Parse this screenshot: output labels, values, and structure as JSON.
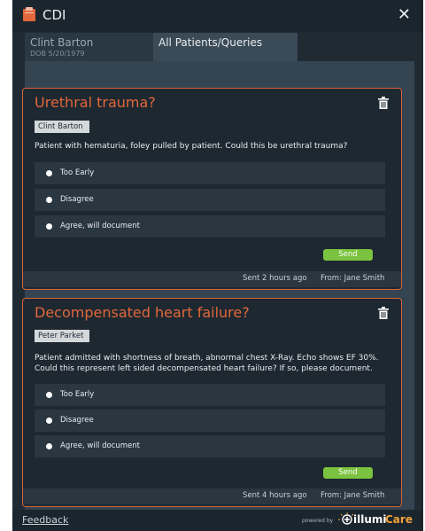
{
  "window": {
    "title": "CDI",
    "app_icon": "clipboard-icon",
    "close_icon": "close-icon"
  },
  "tabs": {
    "patient": {
      "name": "Clint Barton",
      "dob": "DOB 5/20/1979"
    },
    "all": {
      "label": "All Patients/Queries"
    }
  },
  "queries": [
    {
      "title": "Urethral trauma?",
      "patient": "Clint Barton",
      "text": [
        "Patient with hematuria, foley pulled by patient. Could this be urethral trauma?"
      ],
      "options": [
        "Too Early",
        "Disagree",
        "Agree, will document"
      ],
      "send_label": "Send",
      "sent_time": "Sent 2 hours ago",
      "sent_from": "From: Jane Smith"
    },
    {
      "title": "Decompensated heart failure?",
      "patient": "Peter Parket",
      "text": [
        "Patient admitted with shortness of breath, abnormal chest X-Ray. Echo shows EF 30%.",
        "Could this represent left sided decompensated heart failure? If so, please document."
      ],
      "options": [
        "Too Early",
        "Disagree",
        "Agree, will document"
      ],
      "send_label": "Send",
      "sent_time": "Sent 4 hours ago",
      "sent_from": "From: Jane Smith"
    }
  ],
  "footer": {
    "feedback": "Feedback",
    "powered_by": "powered by",
    "brand_part1": "illumi",
    "brand_part2": "Care"
  },
  "colors": {
    "accent": "#e2673a",
    "send": "#7ac23f",
    "brand_care": "#f0a23b",
    "background": "#1f2a33"
  }
}
